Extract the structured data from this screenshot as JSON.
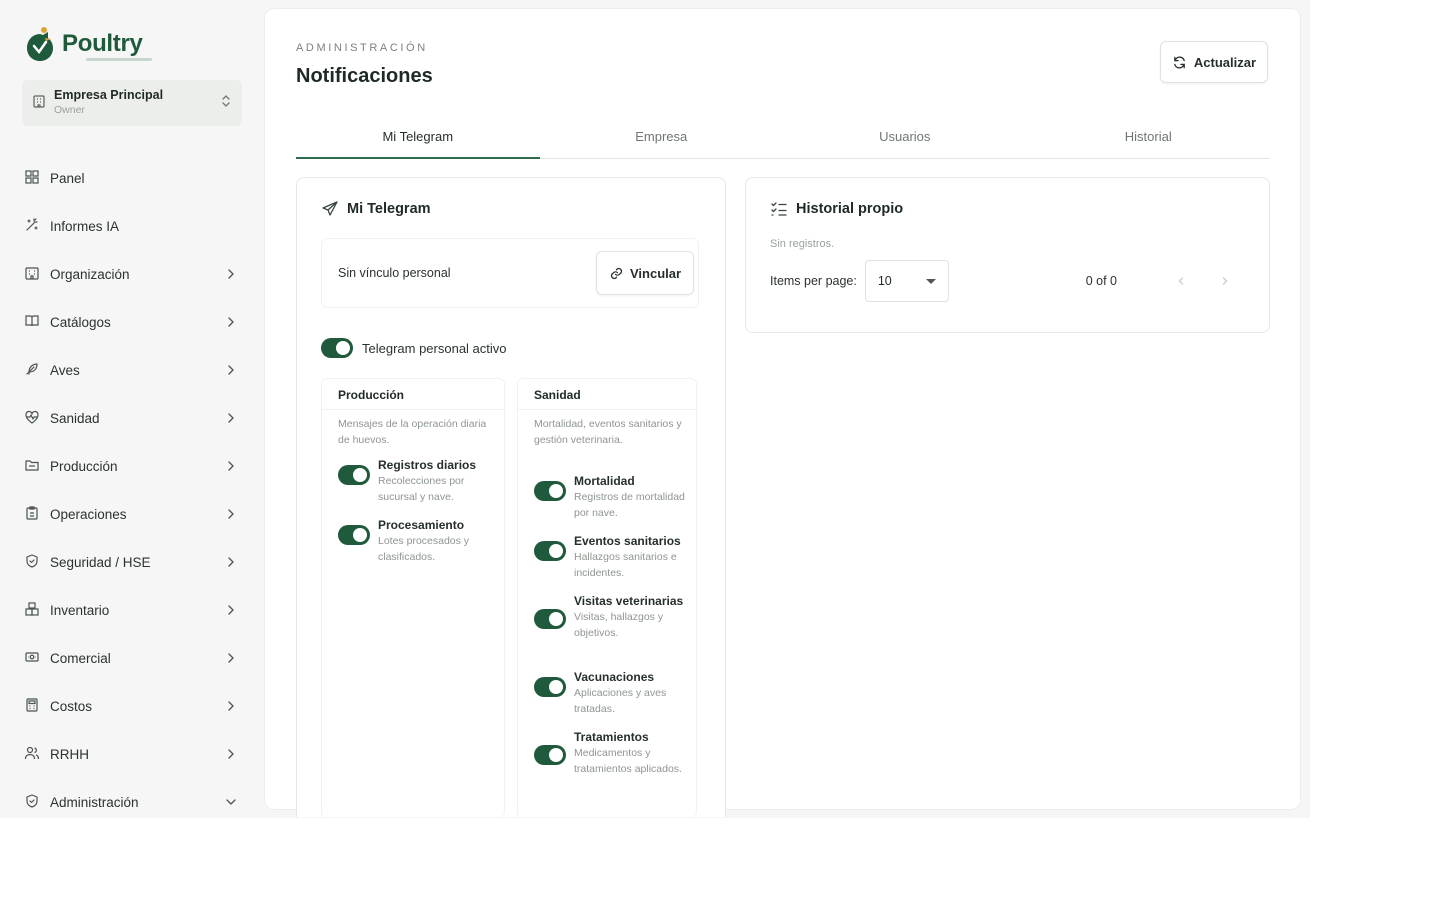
{
  "app": {
    "name": "Poultry"
  },
  "company": {
    "name": "Empresa Principal",
    "role": "Owner"
  },
  "nav": [
    {
      "label": "Panel",
      "icon": "dashboard-icon",
      "chevron": "none"
    },
    {
      "label": "Informes IA",
      "icon": "wand-icon",
      "chevron": "none"
    },
    {
      "label": "Organización",
      "icon": "building-icon",
      "chevron": "right"
    },
    {
      "label": "Catálogos",
      "icon": "book-icon",
      "chevron": "right"
    },
    {
      "label": "Aves",
      "icon": "feather-icon",
      "chevron": "right"
    },
    {
      "label": "Sanidad",
      "icon": "heart-pulse-icon",
      "chevron": "right"
    },
    {
      "label": "Producción",
      "icon": "folder-icon",
      "chevron": "right"
    },
    {
      "label": "Operaciones",
      "icon": "clipboard-icon",
      "chevron": "right"
    },
    {
      "label": "Seguridad / HSE",
      "icon": "shield-icon",
      "chevron": "right"
    },
    {
      "label": "Inventario",
      "icon": "boxes-icon",
      "chevron": "right"
    },
    {
      "label": "Comercial",
      "icon": "banknote-icon",
      "chevron": "right"
    },
    {
      "label": "Costos",
      "icon": "calculator-icon",
      "chevron": "right"
    },
    {
      "label": "RRHH",
      "icon": "users-icon",
      "chevron": "right"
    },
    {
      "label": "Administración",
      "icon": "shield-check-icon",
      "chevron": "down"
    }
  ],
  "header": {
    "eyebrow": "ADMINISTRACIÓN",
    "title": "Notificaciones",
    "refresh_label": "Actualizar"
  },
  "tabs": [
    {
      "label": "Mi Telegram",
      "active": true
    },
    {
      "label": "Empresa",
      "active": false
    },
    {
      "label": "Usuarios",
      "active": false
    },
    {
      "label": "Historial",
      "active": false
    }
  ],
  "telegram": {
    "title": "Mi Telegram",
    "link_status": "Sin vínculo personal",
    "link_button": "Vincular",
    "master_toggle": {
      "label": "Telegram personal activo",
      "on": true
    },
    "produccion": {
      "title": "Producción",
      "desc": "Mensajes de la operación diaria de huevos.",
      "items": [
        {
          "name": "Registros diarios",
          "desc": "Recolecciones por sucursal y nave.",
          "on": true
        },
        {
          "name": "Procesamiento",
          "desc": "Lotes procesados y clasificados.",
          "on": true
        }
      ]
    },
    "sanidad": {
      "title": "Sanidad",
      "desc": "Mortalidad, eventos sanitarios y gestión veterinaria.",
      "items": [
        {
          "name": "Mortalidad",
          "desc": "Registros de mortalidad por nave.",
          "on": true
        },
        {
          "name": "Eventos sanitarios",
          "desc": "Hallazgos sanitarios e incidentes.",
          "on": true
        },
        {
          "name": "Visitas veterinarias",
          "desc": "Visitas, hallazgos y objetivos.",
          "on": true
        },
        {
          "name": "Vacunaciones",
          "desc": "Aplicaciones y aves tratadas.",
          "on": true
        },
        {
          "name": "Tratamientos",
          "desc": "Medicamentos y tratamientos aplicados.",
          "on": true
        }
      ]
    }
  },
  "history": {
    "title": "Historial propio",
    "empty": "Sin registros.",
    "items_per_page_label": "Items per page:",
    "items_per_page": "10",
    "range": "0 of 0"
  },
  "colors": {
    "brand": "#1f5a3c",
    "accent": "#2e6b4a"
  }
}
